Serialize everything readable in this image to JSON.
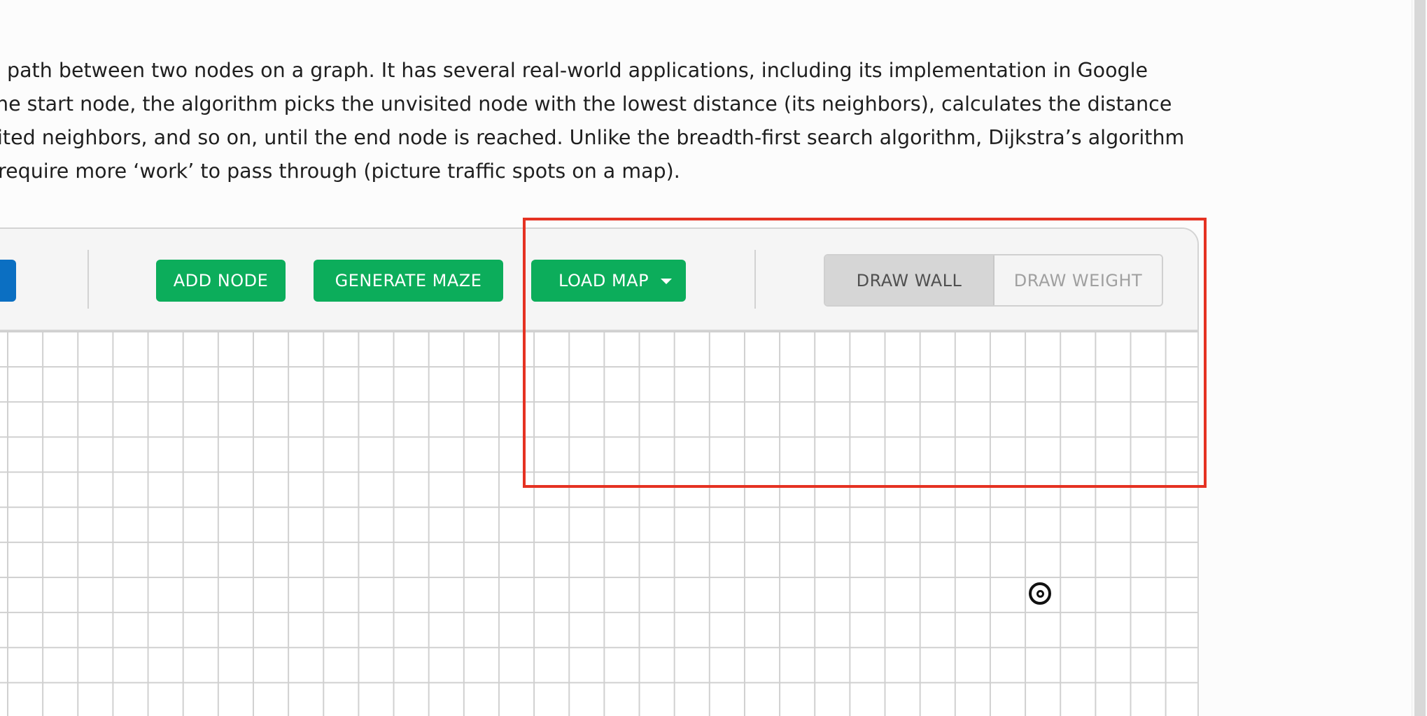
{
  "description": {
    "lines": [
      "path between two nodes on a graph. It has several real-world applications, including its implementation in Google",
      "he start node, the algorithm picks the unvisited node with the lowest distance (its neighbors), calculates the distance",
      "ited neighbors, and so on, until the end node is reached. Unlike the breadth-first search algorithm, Dijkstra’s algorithm",
      "require more ‘work’ to pass through (picture traffic spots on a map)."
    ]
  },
  "toolbar": {
    "run_label": "",
    "add_node_label": "ADD NODE",
    "generate_maze_label": "GENERATE MAZE",
    "load_map_label": "LOAD MAP",
    "draw_wall_label": "DRAW WALL",
    "draw_weight_label": "DRAW WEIGHT",
    "active_draw_mode": "DRAW WALL"
  },
  "grid": {
    "target_node_icon": "target-icon"
  },
  "colors": {
    "primary_green": "#0cad5b",
    "run_blue": "#0b6fc2",
    "highlight_red": "#e53222",
    "grid_line": "#d0d0d0"
  },
  "icons": {
    "load_map_caret": "caret-down-icon",
    "end_node": "target-icon"
  }
}
